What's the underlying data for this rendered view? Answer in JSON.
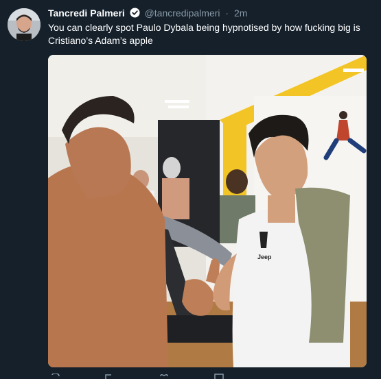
{
  "tweet": {
    "display_name": "Tancredi Palmeri",
    "handle": "@tancredipalmeri",
    "separator": "·",
    "timestamp": "2m",
    "text": "You can clearly spot Paulo Dybala being hypnotised by how fucking big is Cristiano’s Adam’s apple"
  },
  "media": {
    "shirt_text": "Jeep"
  },
  "icons": {
    "avatar": "avatar",
    "verified": "verified-badge-icon",
    "reply": "reply-icon",
    "retweet": "retweet-icon",
    "like": "heart-icon",
    "message": "direct-message-icon"
  },
  "colors": {
    "background": "#15202b",
    "text": "#ffffff",
    "secondary_text": "#8899a6"
  }
}
